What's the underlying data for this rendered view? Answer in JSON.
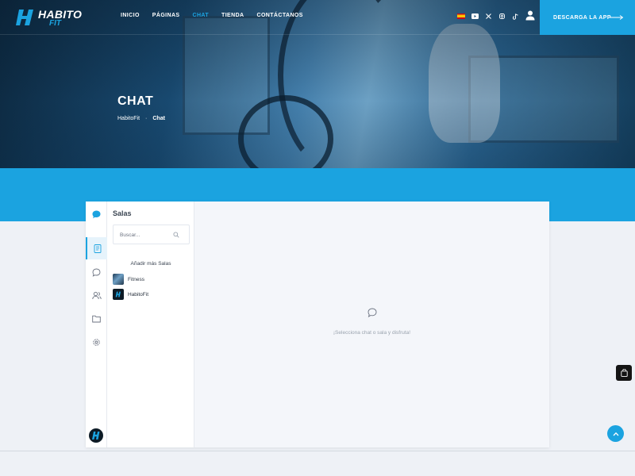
{
  "nav": {
    "logo_word1": "HABITO",
    "logo_word2": "FIT",
    "menu": [
      {
        "label": "INICIO",
        "active": false
      },
      {
        "label": "PÁGINAS",
        "active": false
      },
      {
        "label": "CHAT",
        "active": true
      },
      {
        "label": "TIENDA",
        "active": false
      },
      {
        "label": "CONTÁCTANOS",
        "active": false
      }
    ],
    "social_icons": [
      "spain-flag-icon",
      "youtube-icon",
      "x-icon",
      "instagram-icon",
      "tiktok-icon"
    ],
    "app_button_label": "DESCARGA LA APP"
  },
  "hero": {
    "title": "CHAT",
    "breadcrumb": [
      "HabitoFit",
      "Chat"
    ],
    "separator": "·"
  },
  "chat": {
    "rooms_title": "Salas",
    "search_placeholder": "Buscar...",
    "add_rooms_label": "Añadir más Salas",
    "rooms": [
      {
        "name": "Fitness"
      },
      {
        "name": "HabitoFit"
      }
    ],
    "empty_message": "¡Selecciona chat o sala y disfruta!"
  },
  "colors": {
    "accent": "#1ba3e0",
    "background": "#eef1f6",
    "dark": "#141414"
  }
}
